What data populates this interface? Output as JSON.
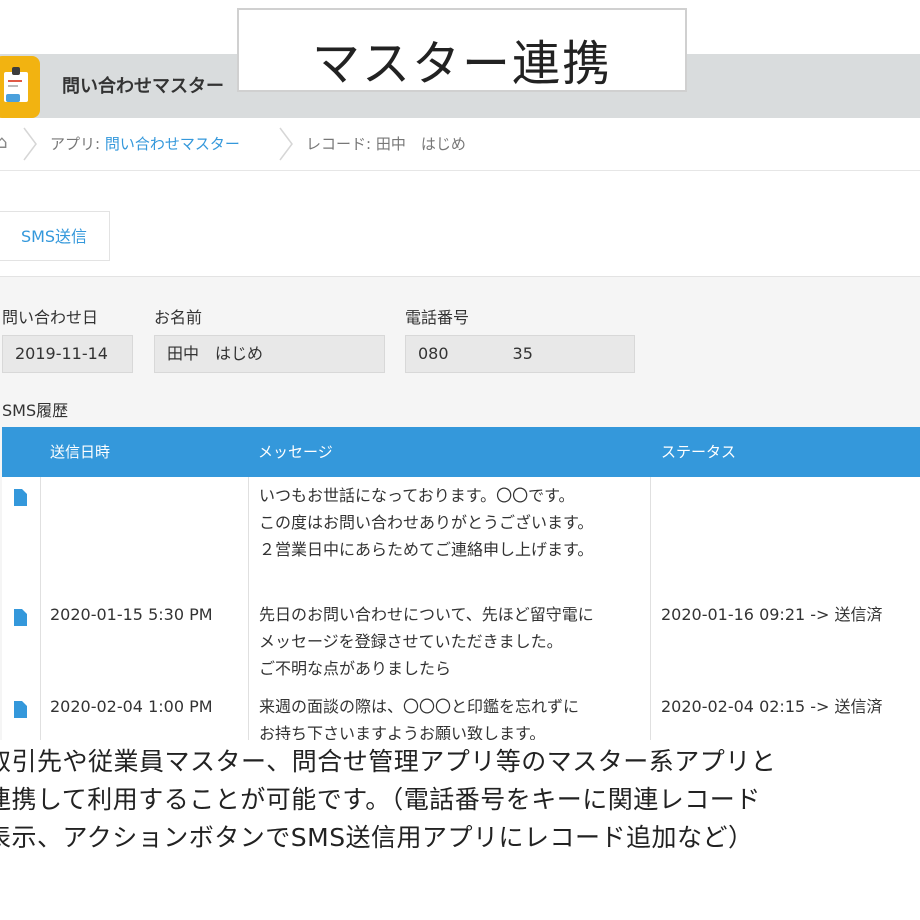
{
  "banner": {
    "title": "マスター連携"
  },
  "app": {
    "title": "問い合わせマスター"
  },
  "breadcrumb": {
    "app_prefix": "アプリ: ",
    "app_link": "問い合わせマスター",
    "record": "レコード: 田中　はじめ"
  },
  "toolbar": {
    "sms_button": "SMS送信"
  },
  "form": {
    "date_label": "問い合わせ日",
    "date_value": "2019-11-14",
    "name_label": "お名前",
    "name_value": "田中　はじめ",
    "phone_label": "電話番号",
    "phone_value": "080　　　　35",
    "history_label": "SMS履歴"
  },
  "table": {
    "headers": [
      "送信日時",
      "メッセージ",
      "ステータス"
    ],
    "rows": [
      {
        "date": "",
        "lines": [
          "いつもお世話になっております。〇〇です。",
          "この度はお問い合わせありがとうございます。",
          "２営業日中にあらためてご連絡申し上げます。"
        ],
        "status": ""
      },
      {
        "date": "2020-01-15 5:30 PM",
        "lines": [
          "先日のお問い合わせについて、先ほど留守電に",
          "メッセージを登録させていただきました。",
          "ご不明な点がありましたら"
        ],
        "status": "2020-01-16 09:21 -> 送信済"
      },
      {
        "date": "2020-02-04 1:00 PM",
        "lines": [
          "来週の面談の際は、〇〇〇と印鑑を忘れずに",
          "お持ち下さいますようお願い致します。"
        ],
        "status": "2020-02-04 02:15 -> 送信済"
      }
    ]
  },
  "caption": {
    "lines": [
      "取引先や従業員マスター、問合せ管理アプリ等のマスター系アプリと",
      "連携して利用することが可能です。（電話番号をキーに関連レコード",
      "表示、アクションボタンでSMS送信用アプリにレコード追加など）"
    ]
  },
  "colors": {
    "accent": "#3498db",
    "header_bg": "#d9dcdd",
    "icon": "#f2b311"
  },
  "icons": [
    "home-icon",
    "app-icon",
    "document-icon"
  ]
}
